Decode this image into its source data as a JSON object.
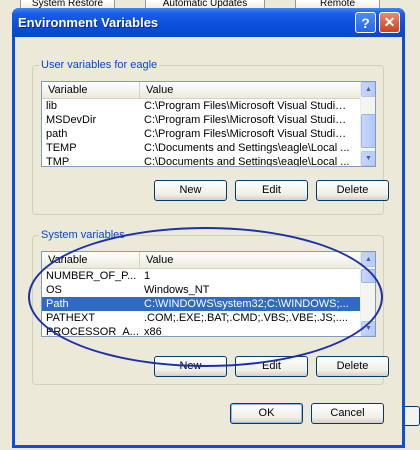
{
  "background": {
    "tabs": [
      "System Restore",
      "Automatic Updates",
      "Remote"
    ]
  },
  "dialog": {
    "title": "Environment Variables",
    "help_glyph": "?",
    "close_glyph": "✕"
  },
  "user_vars": {
    "group_label": "User variables for eagle",
    "columns": [
      "Variable",
      "Value"
    ],
    "rows": [
      {
        "name": "lib",
        "value": "C:\\Program Files\\Microsoft Visual Studio..."
      },
      {
        "name": "MSDevDir",
        "value": "C:\\Program Files\\Microsoft Visual Studio..."
      },
      {
        "name": "path",
        "value": "C:\\Program Files\\Microsoft Visual Studio..."
      },
      {
        "name": "TEMP",
        "value": "C:\\Documents and Settings\\eagle\\Local ..."
      },
      {
        "name": "TMP",
        "value": "C:\\Documents and Settings\\eagle\\Local ..."
      }
    ],
    "buttons": {
      "new": "New",
      "edit": "Edit",
      "delete": "Delete"
    }
  },
  "system_vars": {
    "group_label": "System variables",
    "columns": [
      "Variable",
      "Value"
    ],
    "rows": [
      {
        "name": "NUMBER_OF_P...",
        "value": "1"
      },
      {
        "name": "OS",
        "value": "Windows_NT"
      },
      {
        "name": "Path",
        "value": "C:\\WINDOWS\\system32;C:\\WINDOWS;...",
        "selected": true
      },
      {
        "name": "PATHEXT",
        "value": ".COM;.EXE;.BAT;.CMD;.VBS;.VBE;.JS;...."
      },
      {
        "name": "PROCESSOR_A...",
        "value": "x86"
      }
    ],
    "buttons": {
      "new": "New",
      "edit": "Edit",
      "delete": "Delete"
    }
  },
  "footer": {
    "ok": "OK",
    "cancel": "Cancel"
  },
  "colors": {
    "accent": "#0046d5",
    "selection": "#316ac5",
    "annotation": "#1c2fa8"
  }
}
